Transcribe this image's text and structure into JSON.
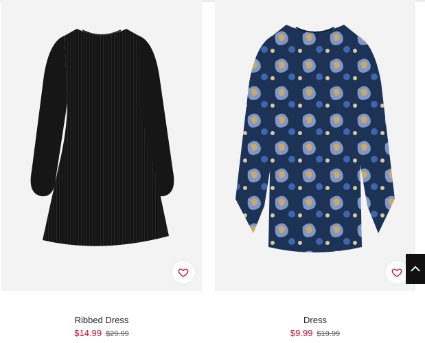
{
  "products": [
    {
      "name": "Ribbed Dress",
      "sale_price": "$14.99",
      "original_price": "$29.99",
      "favorite_icon": "heart-outline-icon",
      "accent": "#d0021b"
    },
    {
      "name": "Dress",
      "sale_price": "$9.99",
      "original_price": "$19.99",
      "favorite_icon": "heart-outline-icon",
      "accent": "#d0021b"
    }
  ],
  "scroll_top_icon": "chevron-up-icon"
}
